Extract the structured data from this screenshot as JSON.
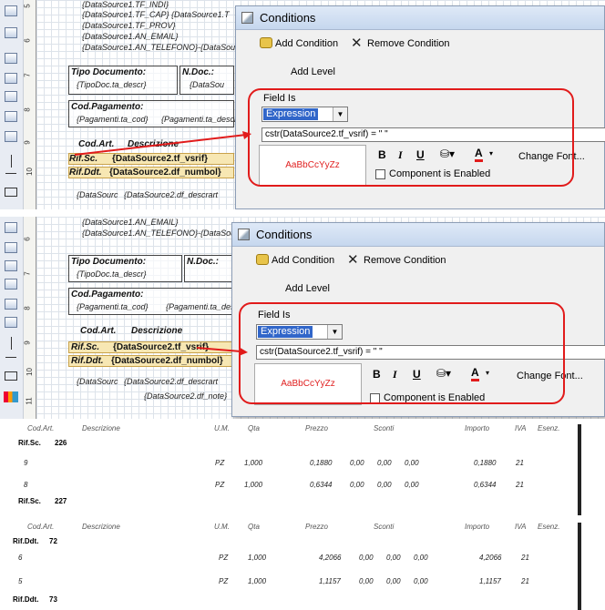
{
  "designer": {
    "ruler_numbers": [
      "5",
      "6",
      "7",
      "8",
      "9",
      "10",
      "11"
    ],
    "panel1_fields": [
      "{DataSource1.TF_INDI}",
      "{DataSource1.TF_CAP} {DataSource1.T",
      "{DataSource1.TF_PROV}",
      "{DataSource1.AN_EMAIL}",
      "{DataSource1.AN_TELEFONO}-{DataSou"
    ],
    "panel2_fields": [
      "{DataSource1.AN_EMAIL}",
      "{DataSource1.AN_TELEFONO}-{DataSou"
    ],
    "tipo_documento_label": "Tipo Documento:",
    "tipo_documento_value": "{TipoDoc.ta_descr}",
    "ndoc_label": "N.Doc.:",
    "ndoc_value": "{DataSou",
    "cod_pagamento_label": "Cod.Pagamento:",
    "cod_pagamento_value": "{Pagamenti.ta_cod}",
    "pagamento_descr": "{Pagamenti.ta_descr",
    "cod_art": "Cod.Art.",
    "descrizione": "Descrizione",
    "rif_sc": "Rif.Sc.",
    "rif_sc_value": "{DataSource2.tf_vsrif}",
    "rif_ddt": "Rif.Ddt.",
    "rif_ddt_value": "{DataSource2.df_numbol}",
    "detail_1": "{DataSourc",
    "detail_2": "{DataSource2.df_descrart",
    "detail_3": "{DataSource2.df_note}"
  },
  "dialog": {
    "title": "Conditions",
    "add_condition": "Add Condition",
    "remove_condition": "Remove Condition",
    "add_level": "Add Level",
    "field_is": "Field Is",
    "field_type": "Expression",
    "expression": "cstr(DataSource2.tf_vsrif) = \" \"",
    "preview": "AaBbCcYyZz",
    "bold": "B",
    "italic": "I",
    "underline": "U",
    "font_color_letter": "A",
    "component_enabled": "Component is Enabled",
    "change_font": "Change Font..."
  },
  "report1": {
    "headers": [
      "Cod.Art.",
      "Descrizione",
      "U.M.",
      "Qta",
      "Prezzo",
      "Sconti",
      "Importo",
      "IVA",
      "Esenz."
    ],
    "rif_label": "Rif.Sc.",
    "rif_value": "226",
    "rows": [
      {
        "code": "9",
        "um": "PZ",
        "qta": "1,000",
        "prezzo": "0,1880",
        "s1": "0,00",
        "s2": "0,00",
        "s3": "0,00",
        "importo": "0,1880",
        "iva": "21"
      },
      {
        "code": "8",
        "um": "PZ",
        "qta": "1,000",
        "prezzo": "0,6344",
        "s1": "0,00",
        "s2": "0,00",
        "s3": "0,00",
        "importo": "0,6344",
        "iva": "21"
      }
    ],
    "next_label": "Rif.Sc.",
    "next_value": "227"
  },
  "report2": {
    "headers": [
      "Cod.Art.",
      "Descrizione",
      "U.M.",
      "Qta",
      "Prezzo",
      "Sconti",
      "Importo",
      "IVA",
      "Esenz."
    ],
    "rif_label": "Rif.Ddt.",
    "rif_value": "72",
    "rows": [
      {
        "code": "6",
        "um": "PZ",
        "qta": "1,000",
        "prezzo": "4,2066",
        "s1": "0,00",
        "s2": "0,00",
        "s3": "0,00",
        "importo": "4,2066",
        "iva": "21"
      },
      {
        "code": "5",
        "um": "PZ",
        "qta": "1,000",
        "prezzo": "1,1157",
        "s1": "0,00",
        "s2": "0,00",
        "s3": "0,00",
        "importo": "1,1157",
        "iva": "21"
      }
    ],
    "next_label": "Rif.Ddt.",
    "next_value": "73"
  },
  "colors": {
    "highlight": "#e11b1b",
    "preview_text": "#e02020",
    "selection": "#3166c9"
  }
}
